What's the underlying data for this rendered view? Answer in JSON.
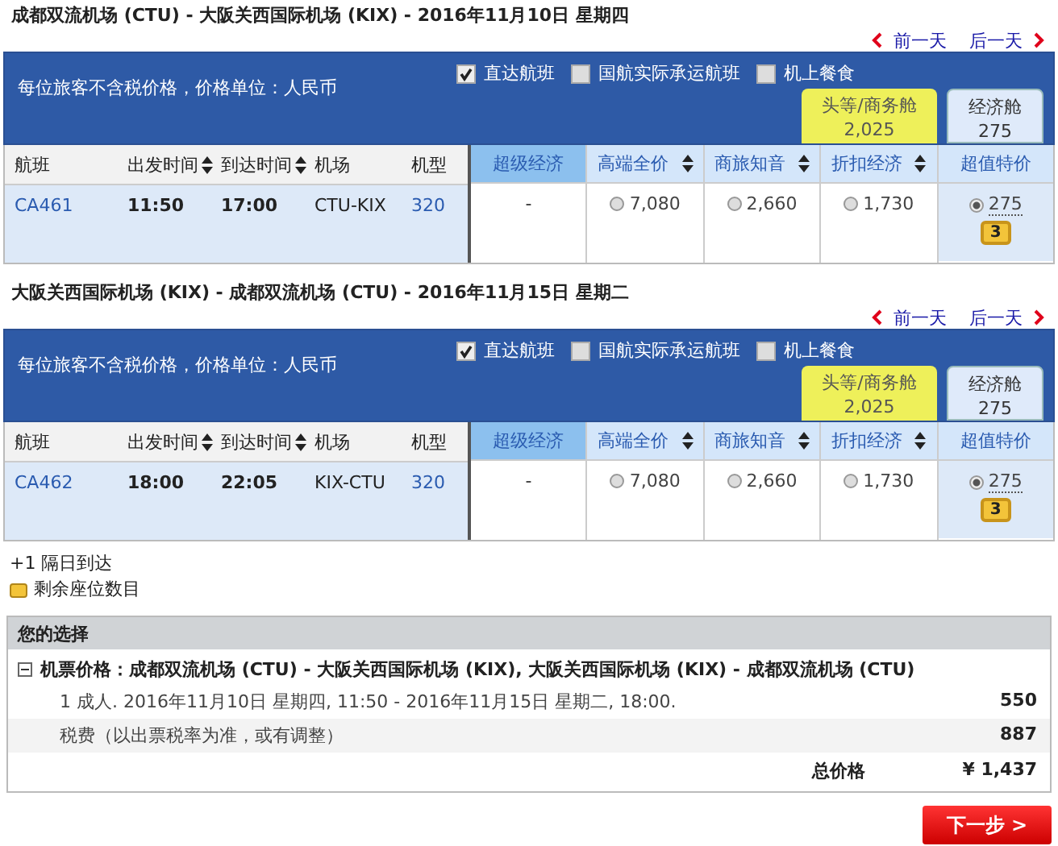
{
  "segments": [
    {
      "title": "成都双流机场 (CTU) - 大阪关西国际机场 (KIX) - 2016年11月10日 星期四",
      "prev_day": "前一天",
      "next_day": "后一天",
      "price_note": "每位旅客不含税价格，价格单位：人民币",
      "filters": [
        {
          "label": "直达航班",
          "checked": true
        },
        {
          "label": "国航实际承运航班",
          "checked": false
        },
        {
          "label": "机上餐食",
          "checked": false
        }
      ],
      "cabin_tabs": [
        {
          "label": "头等/商务舱",
          "price": "2,025",
          "selected": false
        },
        {
          "label": "经济舱",
          "price": "275",
          "selected": true
        }
      ],
      "info_columns": [
        {
          "label": "航班",
          "sortable": false
        },
        {
          "label": "出发时间",
          "sortable": true
        },
        {
          "label": "到达时间",
          "sortable": true
        },
        {
          "label": "机场",
          "sortable": false
        },
        {
          "label": "机型",
          "sortable": false
        }
      ],
      "fare_columns": [
        {
          "label": "超级经济",
          "sortable": false,
          "dimmed": true
        },
        {
          "label": "高端全价",
          "sortable": true,
          "dimmed": false
        },
        {
          "label": "商旅知音",
          "sortable": true,
          "dimmed": false
        },
        {
          "label": "折扣经济",
          "sortable": true,
          "dimmed": false
        },
        {
          "label": "超值特价",
          "sortable": false,
          "dimmed": false
        }
      ],
      "flight": {
        "number": "CA461",
        "departure": "11:50",
        "arrival": "17:00",
        "route": "CTU-KIX",
        "aircraft": "320",
        "fares": [
          {
            "kind": "unavailable",
            "text": "-"
          },
          {
            "kind": "option",
            "price": "7,080",
            "selected": false
          },
          {
            "kind": "option",
            "price": "2,660",
            "selected": false
          },
          {
            "kind": "option",
            "price": "1,730",
            "selected": false
          },
          {
            "kind": "option",
            "price": "275",
            "selected": true,
            "seats": "3"
          }
        ]
      }
    },
    {
      "title": "大阪关西国际机场 (KIX) - 成都双流机场 (CTU) - 2016年11月15日 星期二",
      "prev_day": "前一天",
      "next_day": "后一天",
      "price_note": "每位旅客不含税价格，价格单位：人民币",
      "filters": [
        {
          "label": "直达航班",
          "checked": true
        },
        {
          "label": "国航实际承运航班",
          "checked": false
        },
        {
          "label": "机上餐食",
          "checked": false
        }
      ],
      "cabin_tabs": [
        {
          "label": "头等/商务舱",
          "price": "2,025",
          "selected": false
        },
        {
          "label": "经济舱",
          "price": "275",
          "selected": true
        }
      ],
      "info_columns": [
        {
          "label": "航班",
          "sortable": false
        },
        {
          "label": "出发时间",
          "sortable": true
        },
        {
          "label": "到达时间",
          "sortable": true
        },
        {
          "label": "机场",
          "sortable": false
        },
        {
          "label": "机型",
          "sortable": false
        }
      ],
      "fare_columns": [
        {
          "label": "超级经济",
          "sortable": false,
          "dimmed": true
        },
        {
          "label": "高端全价",
          "sortable": true,
          "dimmed": false
        },
        {
          "label": "商旅知音",
          "sortable": true,
          "dimmed": false
        },
        {
          "label": "折扣经济",
          "sortable": true,
          "dimmed": false
        },
        {
          "label": "超值特价",
          "sortable": false,
          "dimmed": false
        }
      ],
      "flight": {
        "number": "CA462",
        "departure": "18:00",
        "arrival": "22:05",
        "route": "KIX-CTU",
        "aircraft": "320",
        "fares": [
          {
            "kind": "unavailable",
            "text": "-"
          },
          {
            "kind": "option",
            "price": "7,080",
            "selected": false
          },
          {
            "kind": "option",
            "price": "2,660",
            "selected": false
          },
          {
            "kind": "option",
            "price": "1,730",
            "selected": false
          },
          {
            "kind": "option",
            "price": "275",
            "selected": true,
            "seats": "3"
          }
        ]
      }
    }
  ],
  "legend": {
    "next_day": "+1 隔日到达",
    "seats": "剩余座位数目"
  },
  "summary": {
    "title": "您的选择",
    "expanded": true,
    "ticket_label": "机票价格：成都双流机场 (CTU) - 大阪关西国际机场 (KIX), 大阪关西国际机场 (KIX) - 成都双流机场 (CTU)",
    "rows": [
      {
        "label": "1 成人. 2016年11月10日 星期四, 11:50 - 2016年11月15日 星期二, 18:00.",
        "value": "550"
      },
      {
        "label": "税费（以出票税率为准，或有调整）",
        "value": "887"
      }
    ],
    "total_label": "总价格",
    "total": "¥ 1,437"
  },
  "next_button": "下一步 >"
}
